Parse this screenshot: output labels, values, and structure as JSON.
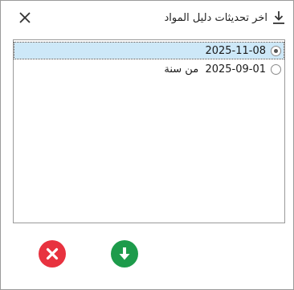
{
  "dialog": {
    "title": "اخر تحديثات دليل المواد",
    "title_icon": "download-arrow-icon",
    "close_icon": "close-icon"
  },
  "list": {
    "items": [
      {
        "label": "2025-11-08",
        "selected": true
      },
      {
        "label": "2025-09-01  من سنة",
        "selected": false
      }
    ]
  },
  "buttons": {
    "cancel_icon": "cancel-circle-icon",
    "cancel_color": "#e8323f",
    "download_icon": "download-circle-icon",
    "download_color": "#1d9b4b"
  },
  "colors": {
    "selection_bg": "#cde8f8",
    "border": "#9a9a9a"
  }
}
